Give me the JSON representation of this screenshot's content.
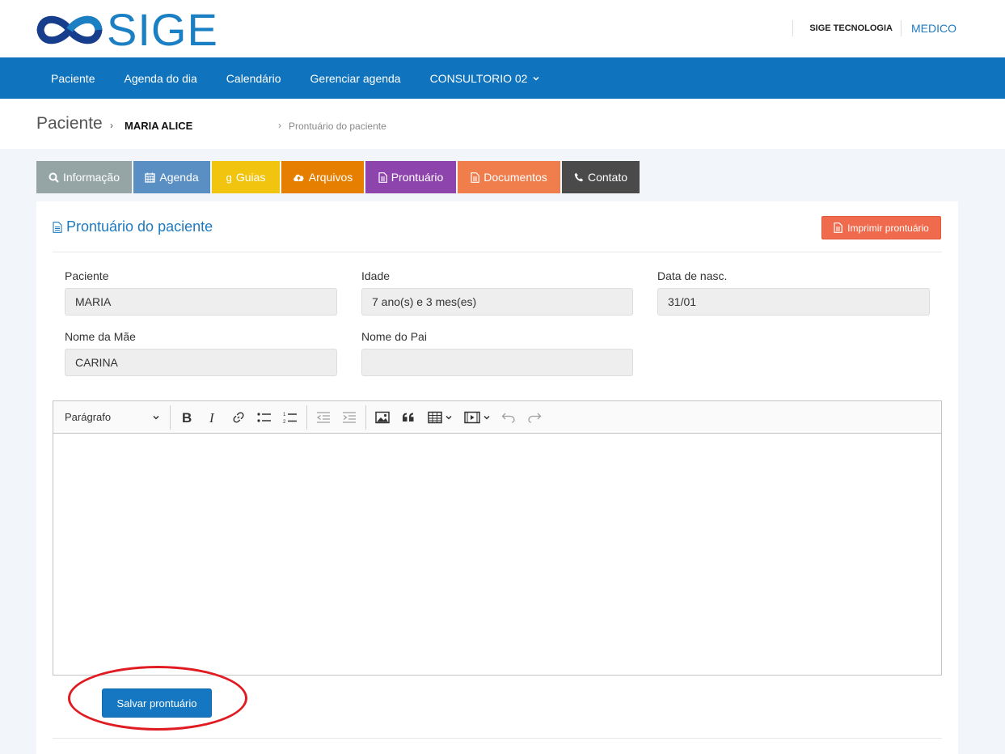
{
  "header": {
    "logo_text": "SIGE",
    "company": "SIGE TECNOLOGIA",
    "role": "MEDICO"
  },
  "nav": {
    "items": [
      "Paciente",
      "Agenda do dia",
      "Calendário",
      "Gerenciar agenda",
      "CONSULTORIO 02"
    ]
  },
  "breadcrumb": {
    "title": "Paciente",
    "patient": "MARIA ALICE",
    "page": "Prontuário do paciente"
  },
  "tabs": [
    {
      "label": "Informação",
      "color": "#95a5a6",
      "icon": "search-icon"
    },
    {
      "label": "Agenda",
      "color": "#5a8fc4",
      "icon": "calendar-icon"
    },
    {
      "label": "Guias",
      "color": "#f1c40f",
      "icon": "google-icon"
    },
    {
      "label": "Arquivos",
      "color": "#e67e00",
      "icon": "cloud-upload-icon"
    },
    {
      "label": "Prontuário",
      "color": "#8e44ad",
      "icon": "document-icon"
    },
    {
      "label": "Documentos",
      "color": "#f07e4d",
      "icon": "document-icon"
    },
    {
      "label": "Contato",
      "color": "#4a4a4a",
      "icon": "phone-icon"
    }
  ],
  "panel": {
    "title": "Prontuário do paciente",
    "print_label": "Imprimir prontuário"
  },
  "fields": {
    "paciente": {
      "label": "Paciente",
      "value": "MARIA"
    },
    "idade": {
      "label": "Idade",
      "value": "7 ano(s) e 3 mes(es)"
    },
    "nascimento": {
      "label": "Data de nasc.",
      "value": "31/01"
    },
    "mae": {
      "label": "Nome da Mãe",
      "value": "CARINA"
    },
    "pai": {
      "label": "Nome do Pai",
      "value": ""
    }
  },
  "editor": {
    "paragraph_label": "Parágrafo",
    "content": ""
  },
  "save_label": "Salvar prontuário",
  "colors": {
    "brand": "#0f73bd",
    "print_button": "#f06b4d",
    "save_button": "#1577c2",
    "highlight": "#e01b22"
  }
}
